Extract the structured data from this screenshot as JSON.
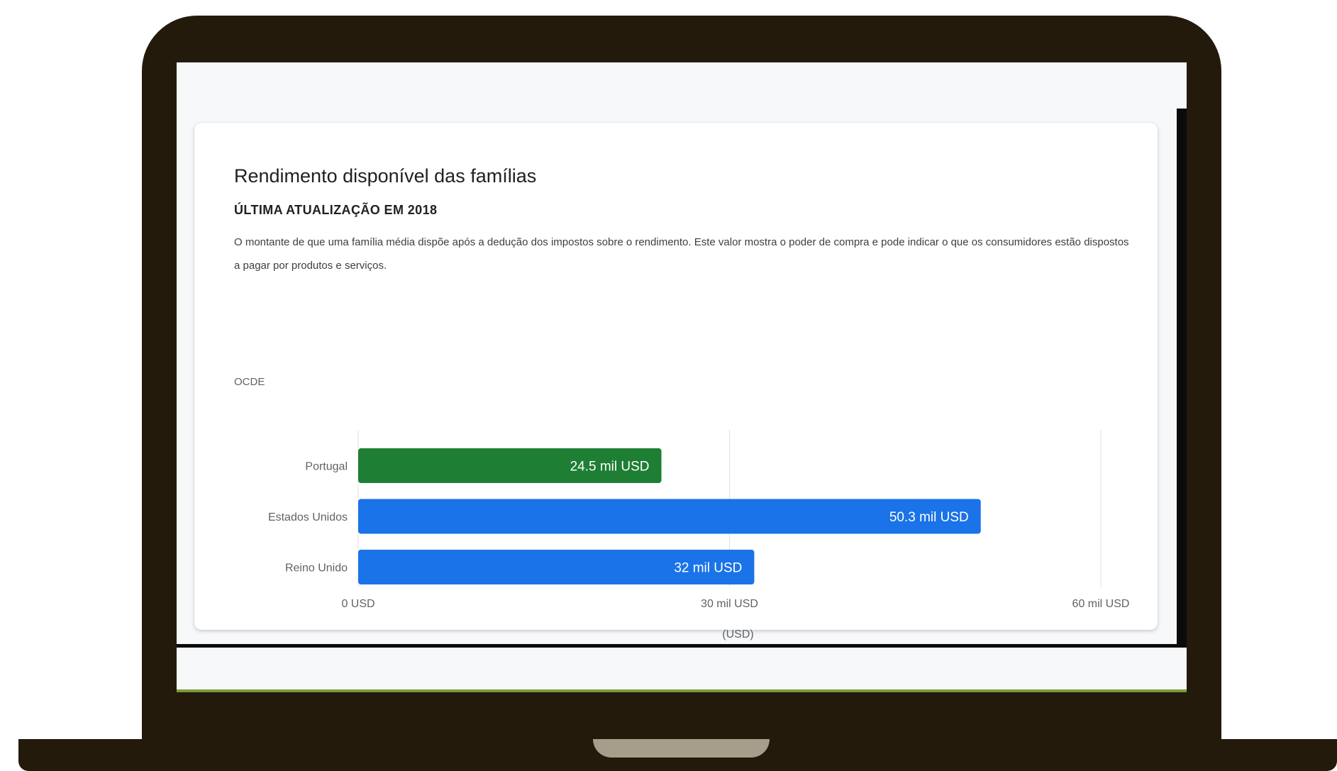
{
  "card": {
    "title": "Rendimento disponível das famílias",
    "subtitle": "ÚLTIMA ATUALIZAÇÃO EM 2018",
    "description": "O montante de que uma família média dispõe após a dedução dos impostos sobre o rendimento. Este valor mostra o poder de compra e pode indicar o que os consumidores estão dispostos a pagar por produtos e serviços.",
    "source": "OCDE"
  },
  "chart_data": {
    "type": "bar",
    "orientation": "horizontal",
    "categories": [
      "Portugal",
      "Estados Unidos",
      "Reino Unido"
    ],
    "values": [
      24.5,
      50.3,
      32
    ],
    "data_labels": [
      "24.5 mil USD",
      "50.3 mil USD",
      "32 mil USD"
    ],
    "bar_colors": [
      "#1e7e34",
      "#1a73e8",
      "#1a73e8"
    ],
    "xlim": [
      0,
      60
    ],
    "xticks": [
      0,
      30,
      60
    ],
    "xtick_labels": [
      "0 USD",
      "30 mil USD",
      "60 mil USD"
    ],
    "xlabel": "(USD)",
    "ylabel": "",
    "grid": true,
    "legend": "none"
  }
}
